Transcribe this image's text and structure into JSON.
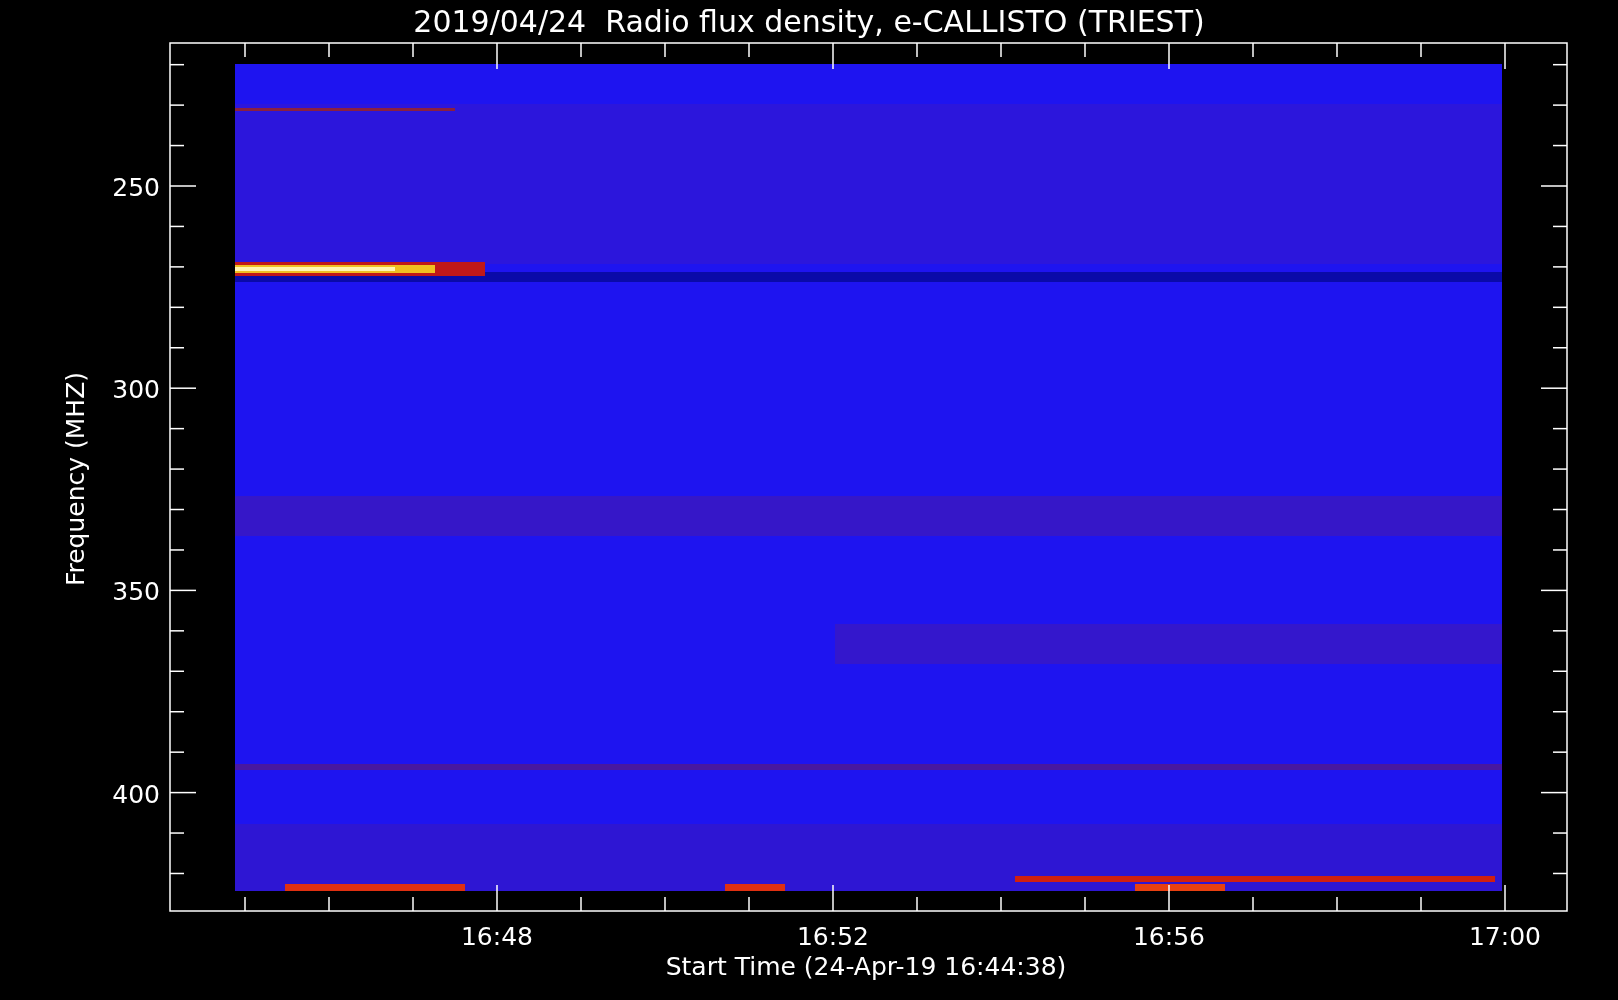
{
  "title": "2019/04/24  Radio flux density, e-CALLISTO (TRIEST)",
  "y_axis": {
    "label": "Frequency (MHZ)",
    "ticks": [
      "250",
      "300",
      "350",
      "400"
    ]
  },
  "x_axis": {
    "label": "Start Time (24-Apr-19 16:44:38)",
    "ticks": [
      "16:48",
      "16:52",
      "16:56",
      "17:00"
    ]
  }
}
